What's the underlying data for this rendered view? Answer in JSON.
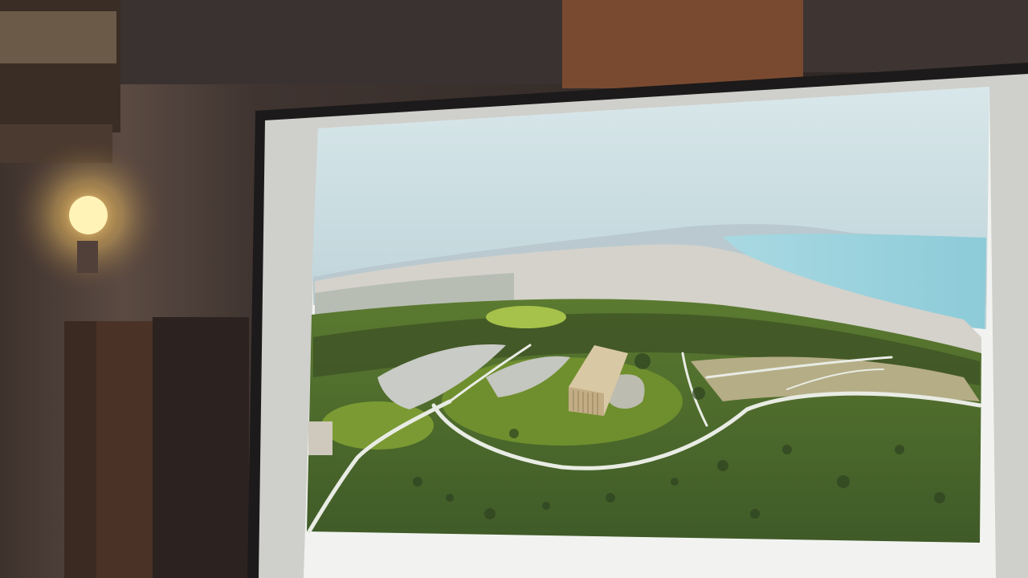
{
  "scene": {
    "kind": "photo-of-projection-screen",
    "colors": {
      "wall": "#4a3d37",
      "ceiling_beam": "#5c3a2a",
      "lamp_glow": "#ffd27a",
      "screen_frame": "#1c1a1a",
      "sky": "#cfe2e6",
      "sea": "#9fd3df",
      "town": "#d8d6d0",
      "fields": "#5f7a34",
      "road": "#e9ece4",
      "temple": "#d9c8a4"
    }
  },
  "lamp": {
    "icon": "wall-lamp-icon"
  },
  "screen": {
    "content": "aerial-photo-ancient-temple-coastal-town"
  }
}
